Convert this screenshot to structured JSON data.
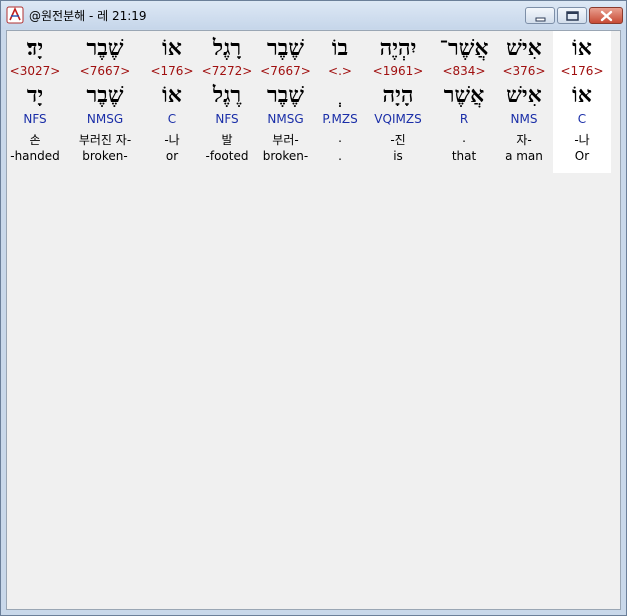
{
  "window": {
    "title": "@원전분해 - 레 21:19"
  },
  "words": [
    {
      "hebrew": "יָד׃",
      "strong": "<3027>",
      "lemma": "יָד",
      "morph": "NFS",
      "korean": "손",
      "english": "-handed"
    },
    {
      "hebrew": "שֶׁבֶר",
      "strong": "<7667>",
      "lemma": "שֶׁבֶר",
      "morph": "NMSG",
      "korean": "부러진 자-",
      "english": "broken-"
    },
    {
      "hebrew": "אוֹ",
      "strong": "<176>",
      "lemma": "אוֹ",
      "morph": "C",
      "korean": "-나",
      "english": "or"
    },
    {
      "hebrew": "רָגֶל",
      "strong": "<7272>",
      "lemma": "רֶגֶל",
      "morph": "NFS",
      "korean": "발",
      "english": "-footed"
    },
    {
      "hebrew": "שֶׁבֶר",
      "strong": "<7667>",
      "lemma": "שֶׁבֶר",
      "morph": "NMSG",
      "korean": "부러-",
      "english": "broken-"
    },
    {
      "hebrew": "בוֹ",
      "strong": "<.>",
      "lemma": "ְ",
      "morph": "P.MZS",
      "korean": ".",
      "english": "."
    },
    {
      "hebrew": "יִהְיֶה",
      "strong": "<1961>",
      "lemma": "הָיָה",
      "morph": "VQIMZS",
      "korean": "-진",
      "english": "is"
    },
    {
      "hebrew": "אֲשֶׁר־",
      "strong": "<834>",
      "lemma": "אֲשֶׁר",
      "morph": "R",
      "korean": ".",
      "english": "that"
    },
    {
      "hebrew": "אִישׁ",
      "strong": "<376>",
      "lemma": "אִישׁ",
      "morph": "NMS",
      "korean": "자-",
      "english": "a man"
    },
    {
      "hebrew": "אוֹ",
      "strong": "<176>",
      "lemma": "אוֹ",
      "morph": "C",
      "korean": "-나",
      "english": "Or"
    }
  ],
  "colors": {
    "strong_number": "#a01010",
    "morphology": "#1a2ea8",
    "selected_column": "#ffffff",
    "content_background": "#f0f0f0"
  },
  "icons": {
    "app": "compass-app-icon",
    "minimize": "minimize-icon",
    "maximize": "maximize-icon",
    "close": "close-icon"
  }
}
